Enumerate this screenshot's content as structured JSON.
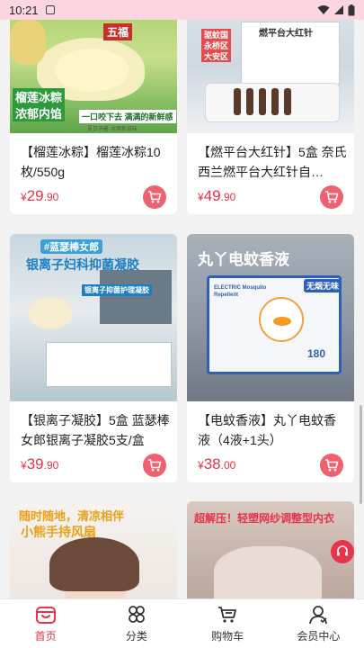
{
  "status": {
    "time": "10:21"
  },
  "products": [
    {
      "title": "【榴莲冰粽】榴莲冰粽10枚/550g",
      "currency": "¥",
      "price_int": "29",
      "price_dec": ".90",
      "overlay": {
        "badge1": "五福",
        "tag_line1": "榴莲冰粽",
        "tag_line2": "浓郁内馅",
        "slogan": "一口咬下去 满满的新鲜感",
        "fine": "夏日消暑·冰爽新滋味"
      }
    },
    {
      "title": "【燃平台大红针】5盒 奈氏西兰燃平台大红针自…",
      "currency": "¥",
      "price_int": "49",
      "price_dec": ".90",
      "overlay": {
        "line1": "驱蚊国",
        "line2": "永桥区",
        "line3": "大安区",
        "box": "燃平台大红针"
      }
    },
    {
      "title": "【银离子凝胶】5盒 蓝瑟棒女郎银离子凝胶5支/盒",
      "currency": "¥",
      "price_int": "39",
      "price_dec": ".90",
      "overlay": {
        "tag": "#蓝瑟棒女郎",
        "headline": "银离子妇科抑菌凝胶",
        "sub": "银离子抑菌护理凝胶"
      }
    },
    {
      "title": "【电蚊香液】丸丫电蚊香液（4液+1头）",
      "currency": "¥",
      "price_int": "38",
      "price_dec": ".00",
      "overlay": {
        "headline": "丸丫电蚊香液",
        "brand": "ELECTRIC Mosquito Repellent",
        "badge": "无烟无味",
        "count": "180"
      }
    },
    {
      "title": "",
      "overlay": {
        "line1": "随时随地，清凉相伴",
        "line2": "小熊手持风扇"
      }
    },
    {
      "title": "",
      "overlay": {
        "line1": "超解压！轻塑网纱调整型内衣"
      }
    }
  ],
  "tabs": [
    {
      "label": "首页",
      "icon": "home-icon",
      "active": true
    },
    {
      "label": "分类",
      "icon": "category-icon",
      "active": false
    },
    {
      "label": "购物车",
      "icon": "cart-icon",
      "active": false
    },
    {
      "label": "会员中心",
      "icon": "user-icon",
      "active": false
    }
  ],
  "colors": {
    "accent": "#e8334a",
    "cart_btn": "#f0616f",
    "status_bg": "#fbd6e0"
  }
}
